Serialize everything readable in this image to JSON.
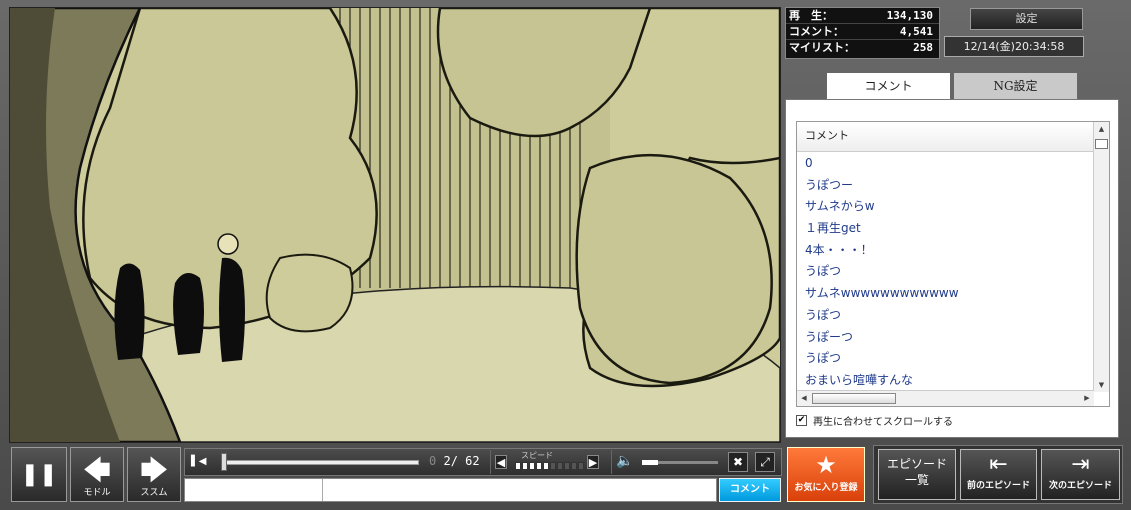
{
  "stats": {
    "plays_label": "再　生：",
    "plays_value": "134,130",
    "comments_label": "コメント：",
    "comments_value": "4,541",
    "mylist_label": "マイリスト：",
    "mylist_value": "258"
  },
  "header": {
    "settings_label": "設定",
    "datetime": "12/14(金)20:34:58"
  },
  "tabs": [
    {
      "label": "コメント",
      "active": true
    },
    {
      "label": "NG設定",
      "active": false
    }
  ],
  "comments": {
    "column_header": "コメント",
    "items": [
      "0",
      "うぽつー",
      "サムネからw",
      "１再生get",
      "4本・・・！",
      "うぽつ",
      "サムネwwwwwwwwwwww",
      "うぽつ",
      "うぽーつ",
      "うぽつ",
      "おまいら喧嘩すんな"
    ],
    "autoscroll_label": "再生に合わせてスクロールする",
    "autoscroll_checked": true
  },
  "player": {
    "pause_glyph": "❚❚",
    "back_label": "モドル",
    "forward_label": "ススム",
    "time_current": "0",
    "time_sep": "2/",
    "time_total": "62",
    "speed_label": "スピード",
    "speed_level": 5,
    "speed_levels": 10,
    "volume_fraction": 0.21,
    "progress_fraction": 0.0
  },
  "comment_input": {
    "command_value": "",
    "text_value": "",
    "submit_label": "コメント"
  },
  "actions": {
    "favorite_label": "お気に入り登録",
    "episode_list_line1": "エピソード",
    "episode_list_line2": "一覧",
    "prev_episode_label": "前のエピソード",
    "next_episode_label": "次のエピソード"
  },
  "colors": {
    "accent_orange": "#e8581a",
    "comment_button": "#11aaee",
    "comment_text": "#1f3a8a"
  }
}
